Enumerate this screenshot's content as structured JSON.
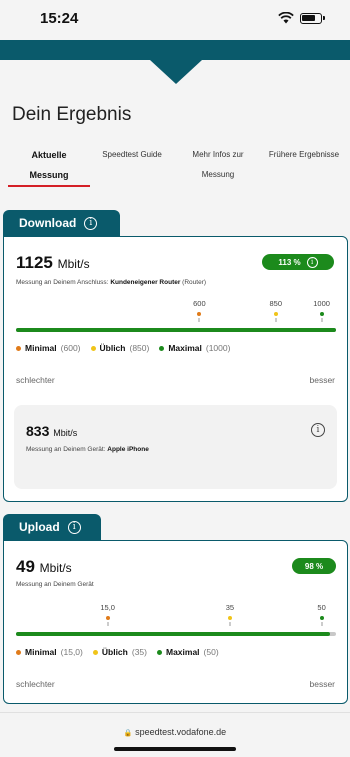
{
  "status": {
    "time": "15:24"
  },
  "page": {
    "title": "Dein Ergebnis"
  },
  "tabs": [
    {
      "line1": "Aktuelle",
      "line2": "Messung"
    },
    {
      "line1": "Speedtest Guide",
      "line2": ""
    },
    {
      "line1": "Mehr Infos zur",
      "line2": "Messung"
    },
    {
      "line1": "Frühere Ergebnisse",
      "line2": ""
    }
  ],
  "download": {
    "section_label": "Download",
    "speed": "1125",
    "unit": "Mbit/s",
    "percent_badge": "113 %",
    "desc_prefix": "Messung an Deinem Anschluss: ",
    "desc_bold": "Kundeneigener Router",
    "desc_suffix": " (Router)",
    "ticks": [
      {
        "label": "600",
        "value": 600,
        "color": "#e07b1a"
      },
      {
        "label": "850",
        "value": 850,
        "color": "#f0c419"
      },
      {
        "label": "1000",
        "value": 1000,
        "color": "#1c8a1c"
      }
    ],
    "fill_fraction": 1.0,
    "legend": [
      {
        "name": "Minimal",
        "value": "(600)",
        "color": "#e07b1a"
      },
      {
        "name": "Üblich",
        "value": "(850)",
        "color": "#f0c419"
      },
      {
        "name": "Maximal",
        "value": "(1000)",
        "color": "#1c8a1c"
      }
    ],
    "worse": "schlechter",
    "better": "besser",
    "device": {
      "speed": "833",
      "unit": "Mbit/s",
      "desc_prefix": "Messung an Deinem Gerät: ",
      "desc_bold": "Apple iPhone"
    }
  },
  "upload": {
    "section_label": "Upload",
    "speed": "49",
    "unit": "Mbit/s",
    "percent_badge": "98 %",
    "desc": "Messung an Deinem Gerät",
    "ticks": [
      {
        "label": "15,0",
        "value": 15,
        "color": "#e07b1a"
      },
      {
        "label": "35",
        "value": 35,
        "color": "#f0c419"
      },
      {
        "label": "50",
        "value": 50,
        "color": "#1c8a1c"
      }
    ],
    "fill_fraction": 0.98,
    "legend": [
      {
        "name": "Minimal",
        "value": "(15,0)",
        "color": "#e07b1a"
      },
      {
        "name": "Üblich",
        "value": "(35)",
        "color": "#f0c419"
      },
      {
        "name": "Maximal",
        "value": "(50)",
        "color": "#1c8a1c"
      }
    ],
    "worse": "schlechter",
    "better": "besser"
  },
  "browser": {
    "url": "speedtest.vodafone.de"
  },
  "colors": {
    "brand": "#0a5a6b",
    "accent_red": "#d41f26",
    "good": "#1c8a1c"
  }
}
